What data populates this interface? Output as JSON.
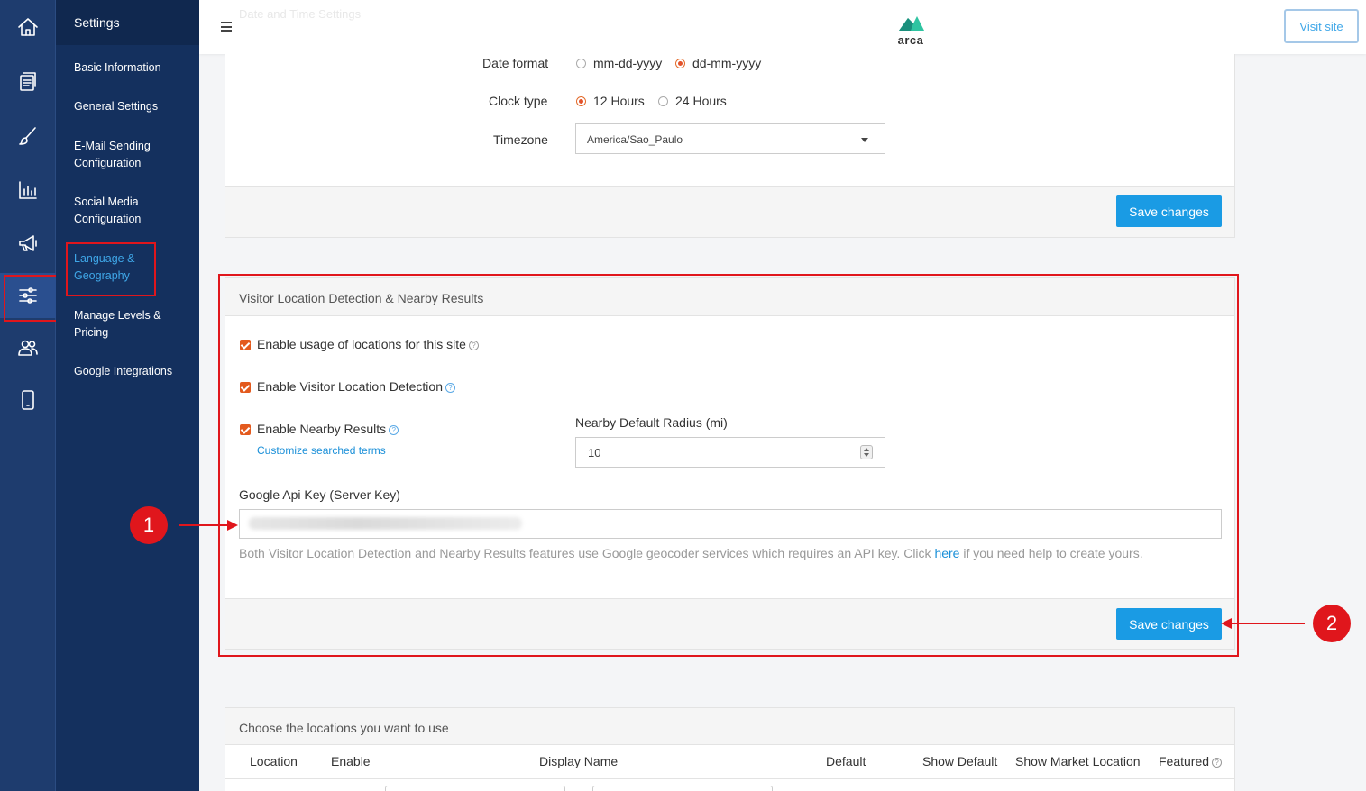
{
  "rail": {
    "icons": [
      "home-icon",
      "pages-icon",
      "brush-icon",
      "chart-icon",
      "megaphone-icon",
      "sliders-icon",
      "users-icon",
      "mobile-icon"
    ],
    "active_index": 5
  },
  "sidebar": {
    "title": "Settings",
    "items": [
      {
        "label": "Basic Information"
      },
      {
        "label": "General Settings"
      },
      {
        "label": "E-Mail Sending Configuration"
      },
      {
        "label": "Social Media Configuration"
      },
      {
        "label": "Language & Geography"
      },
      {
        "label": "Manage Levels & Pricing"
      },
      {
        "label": "Google Integrations"
      }
    ],
    "active_index": 4
  },
  "header": {
    "faded_title": "Date and Time Settings",
    "logo_text": "arca",
    "visit_site": "Visit site"
  },
  "datetime": {
    "date_format_label": "Date format",
    "date_options": [
      "mm-dd-yyyy",
      "dd-mm-yyyy"
    ],
    "date_selected": "dd-mm-yyyy",
    "clock_label": "Clock type",
    "clock_options": [
      "12 Hours",
      "24 Hours"
    ],
    "clock_selected": "12 Hours",
    "timezone_label": "Timezone",
    "timezone_value": "America/Sao_Paulo",
    "save_label": "Save changes"
  },
  "location": {
    "title": "Visitor Location Detection & Nearby Results",
    "enable_usage": "Enable usage of locations for this site",
    "enable_detection": "Enable Visitor Location Detection",
    "enable_nearby": "Enable Nearby Results",
    "customize_link": "Customize searched terms",
    "radius_label": "Nearby Default Radius (mi)",
    "radius_value": "10",
    "api_key_label": "Google Api Key (Server Key)",
    "help_text_before": "Both Visitor Location Detection and Nearby Results features use Google geocoder services which requires an API key. Click",
    "help_link": "here",
    "help_text_after": "if you need help to create yours.",
    "save_label": "Save changes"
  },
  "annotations": {
    "marker_1": "1",
    "marker_2": "2"
  },
  "locations_table": {
    "title": "Choose the locations you want to use",
    "columns": [
      "Location",
      "Enable",
      "Display Name",
      "Default",
      "Show Default",
      "Show Market Location",
      "Featured"
    ]
  },
  "colors": {
    "rail_bg": "#1e3c6e",
    "sidebar_bg": "#14305e",
    "accent_blue": "#1a9be4",
    "active_link": "#3fa7e8",
    "checkbox_orange": "#e35a1e",
    "annotation_red": "#e0161c"
  }
}
